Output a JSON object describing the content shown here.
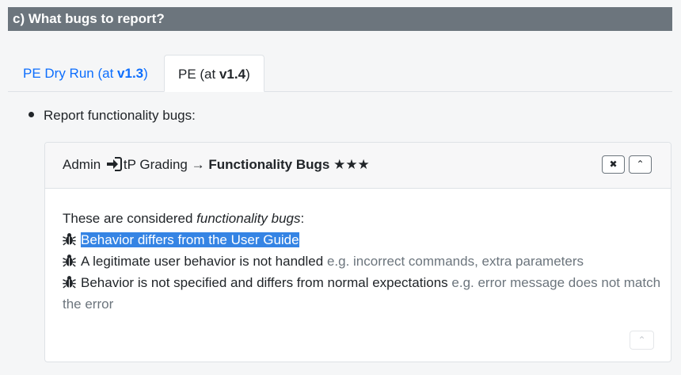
{
  "section": {
    "title": "c) What bugs to report?"
  },
  "tabs": [
    {
      "prefix": "PE Dry Run (at ",
      "version": "v1.3",
      "suffix": ")"
    },
    {
      "prefix": "PE (at ",
      "version": "v1.4",
      "suffix": ")"
    }
  ],
  "bullet": "Report functionality bugs:",
  "card": {
    "title_admin": "Admin",
    "title_mid": "tP Grading →",
    "title_bold": "Functionality Bugs",
    "title_stars": "★★★",
    "close_label": "✖",
    "collapse_label": "⌃",
    "bottom_label": "⌃",
    "intro_prefix": "These are considered ",
    "intro_em": "functionality bugs",
    "intro_suffix": ":",
    "bugs": [
      {
        "text": "Behavior differs from the User Guide",
        "example": ""
      },
      {
        "text": "A legitimate user behavior is not handled",
        "example": "e.g. incorrect commands, extra parameters"
      },
      {
        "text": "Behavior is not specified and differs from normal expectations",
        "example": "e.g. error message does not match the error"
      }
    ]
  },
  "icons": {
    "signin": "sign-in-icon",
    "bug": "bug-icon"
  },
  "colors": {
    "header_bg": "#6c757d",
    "link": "#0d6efd",
    "highlight": "#3584e4"
  }
}
